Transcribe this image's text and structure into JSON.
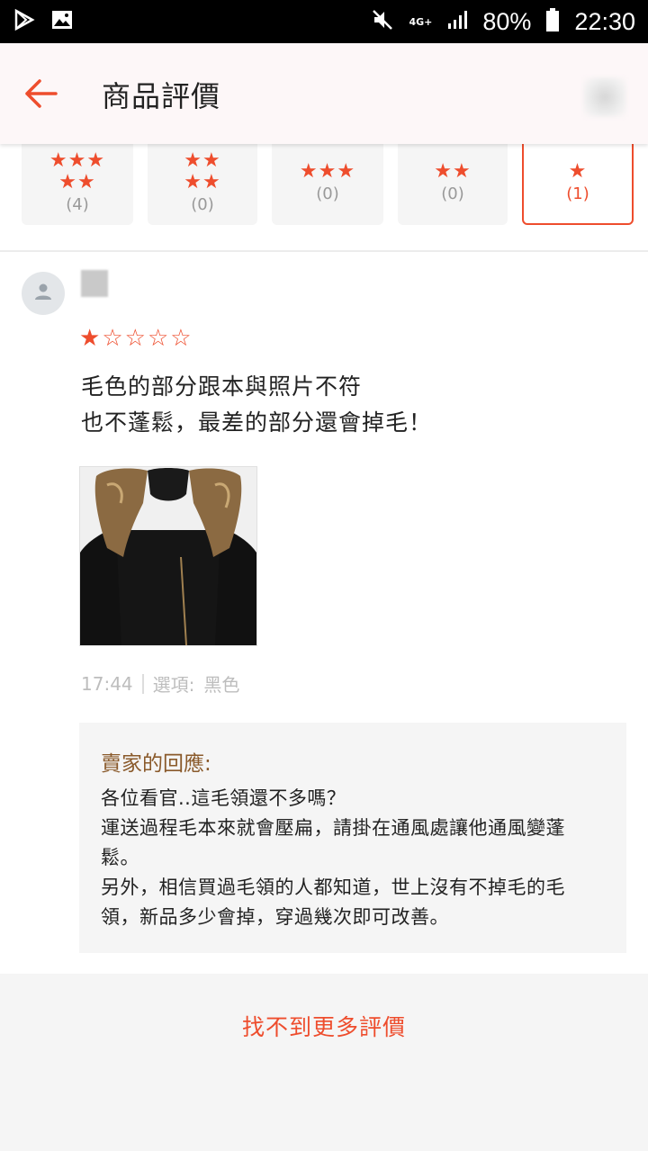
{
  "status_bar": {
    "network": "4G+",
    "battery": "80%",
    "time": "22:30"
  },
  "header": {
    "title": "商品評價"
  },
  "filters": [
    {
      "stars_top": "★★★",
      "stars_bottom": "★★",
      "count": "(4)"
    },
    {
      "stars_top": "★★",
      "stars_bottom": "★★",
      "count": "(0)"
    },
    {
      "stars_top": "★★★",
      "stars_bottom": "",
      "count": "(0)"
    },
    {
      "stars_top": "★★",
      "stars_bottom": "",
      "count": "(0)"
    },
    {
      "stars_top": "★",
      "stars_bottom": "",
      "count": "(1)"
    }
  ],
  "review": {
    "rating": 1,
    "stars": [
      "★",
      "☆",
      "☆",
      "☆",
      "☆"
    ],
    "text_line1": "毛色的部分跟本與照片不符",
    "text_line2": "也不蓬鬆，最差的部分還會掉毛！",
    "time": "17:44",
    "option_label": "選項:",
    "option_value": "黑色"
  },
  "seller_reply": {
    "title": "賣家的回應:",
    "lines": [
      "各位看官..這毛領還不多嗎？",
      "運送過程毛本來就會壓扁，請掛在通風處讓他通風變蓬",
      "鬆。",
      "另外，相信買過毛領的人都知道，世上沒有不掉毛的毛",
      "領，新品多少會掉，穿過幾次即可改善。"
    ]
  },
  "footer": {
    "more_label": "找不到更多評價"
  },
  "colors": {
    "accent": "#ee4d2d",
    "header_bg": "#fdf7f8",
    "seller_title": "#8a5a2b"
  },
  "icons": [
    "play-store-icon",
    "image-icon",
    "mute-icon",
    "signal-icon",
    "battery-icon",
    "back-arrow-icon",
    "user-avatar-icon"
  ]
}
